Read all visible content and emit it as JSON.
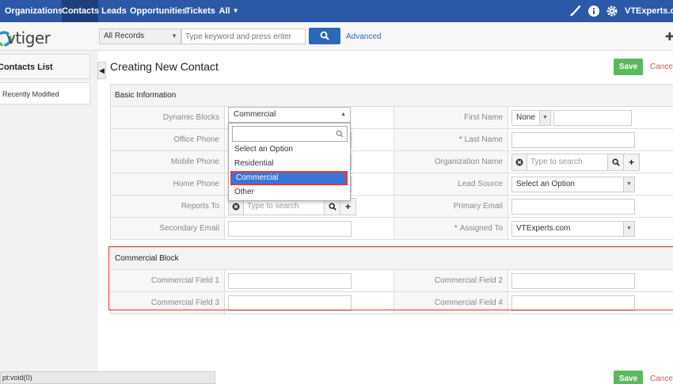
{
  "nav": {
    "items": [
      "Organizations",
      "Contacts",
      "Leads",
      "Opportunities",
      "Tickets",
      "All"
    ],
    "active": "Contacts",
    "user": "VTExperts.com"
  },
  "search": {
    "logo_text": "vtiger",
    "records_filter": "All Records",
    "placeholder": "Type keyword and press enter",
    "advanced_label": "Advanced"
  },
  "sidebar": {
    "title": "Contacts List",
    "items": [
      "Recently Modified"
    ]
  },
  "page": {
    "title": "Creating New Contact",
    "save_label": "Save",
    "cancel_label": "Cancel"
  },
  "basic": {
    "section_title": "Basic Information",
    "dynamic_blocks_label": "Dynamic Blocks",
    "dynamic_blocks_value": "Commercial",
    "office_phone_label": "Office Phone",
    "mobile_phone_label": "Mobile Phone",
    "home_phone_label": "Home Phone",
    "reports_to_label": "Reports To",
    "reports_to_placeholder": "Type to search",
    "secondary_email_label": "Secondary Email",
    "first_name_label": "First Name",
    "salutation_value": "None",
    "last_name_label": "Last Name",
    "organization_label": "Organization Name",
    "organization_placeholder": "Type to search",
    "lead_source_label": "Lead Source",
    "lead_source_value": "Select an Option",
    "primary_email_label": "Primary Email",
    "assigned_to_label": "Assigned To",
    "assigned_to_value": "VTExperts.com"
  },
  "dropdown": {
    "options": [
      "Select an Option",
      "Residential",
      "Commercial",
      "Other"
    ],
    "selected": "Commercial"
  },
  "commercial": {
    "section_title": "Commercial Block",
    "field1_label": "Commercial Field 1",
    "field2_label": "Commercial Field 2",
    "field3_label": "Commercial Field 3",
    "field4_label": "Commercial Field 4"
  },
  "status": {
    "text": "pt:void(0)"
  }
}
